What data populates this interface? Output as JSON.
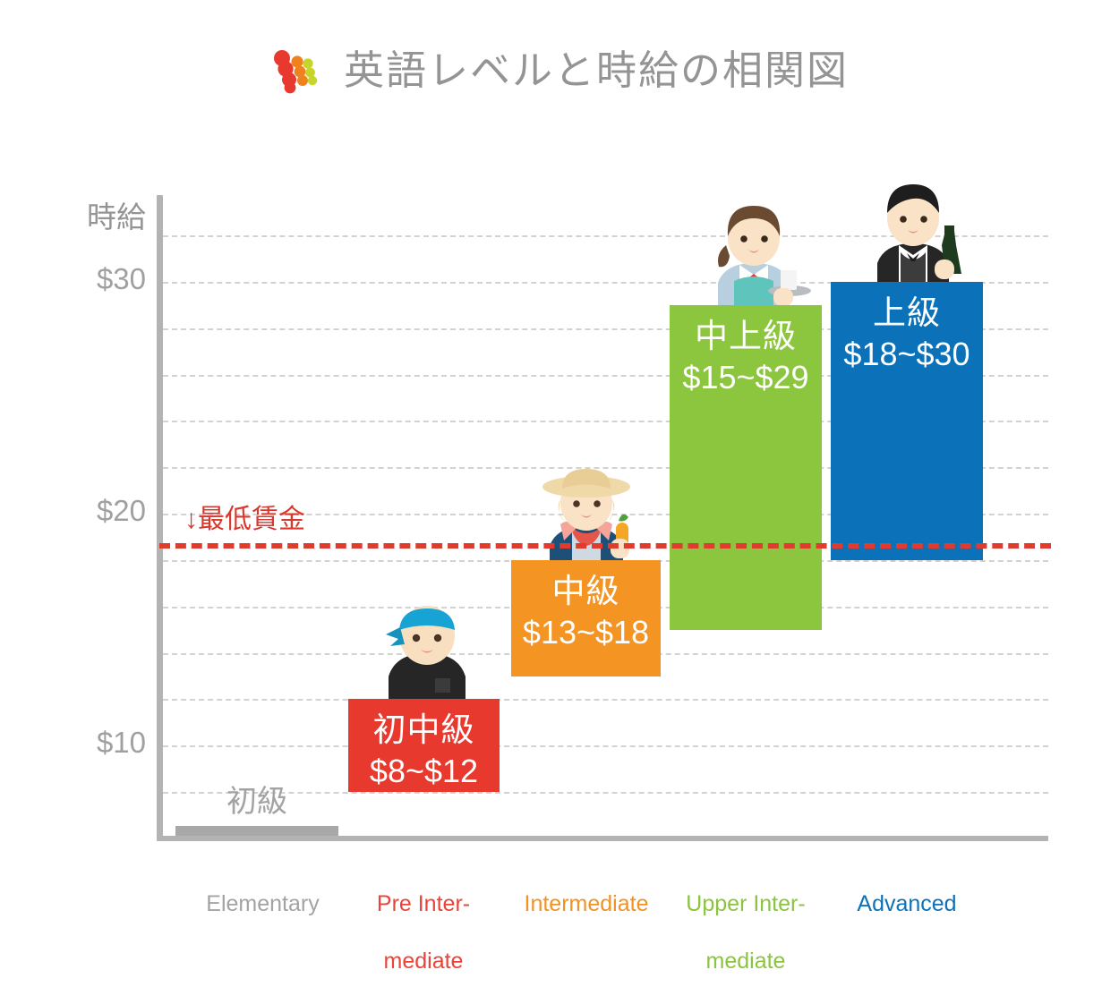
{
  "header": {
    "title": "英語レベルと時給の相関図",
    "logo_name": "three-stroke-brand-logo",
    "logo_colors": [
      "#e8392e",
      "#f0821e",
      "#c7d42a"
    ]
  },
  "chart_data": {
    "type": "bar",
    "title": "英語レベルと時給の相関図",
    "ylabel": "時給",
    "xlabel": "",
    "ylim": [
      0,
      32
    ],
    "grid": true,
    "grid_step": 2,
    "ytick_labels": [
      "$30",
      "$20",
      "$10"
    ],
    "ytick_values": [
      30,
      20,
      10
    ],
    "legend": "none",
    "currency": "USD per hour",
    "categories": [
      "Elementary",
      "Pre Intermediate",
      "Intermediate",
      "Upper Intermediate",
      "Advanced"
    ],
    "category_labels_ja": [
      "初級",
      "初中級",
      "中級",
      "中上級",
      "上級"
    ],
    "bars": [
      {
        "id": "elementary",
        "label_ja": "初級",
        "label_en": "Elementary",
        "label_en_line1": "Elementary",
        "label_en_line2": "",
        "range_text": "",
        "low": 0,
        "high": 0,
        "color": "#a8a8a8",
        "label_color": "#a3a3a3",
        "figure": "none"
      },
      {
        "id": "pre-intermediate",
        "label_ja": "初中級",
        "label_en": "Pre Intermediate",
        "label_en_line1": "Pre Inter-",
        "label_en_line2": "mediate",
        "range_text": "$8~$12",
        "low": 8,
        "high": 12,
        "color": "#e8392e",
        "label_color": "#e8453a",
        "figure": "boy-blue-bandana"
      },
      {
        "id": "intermediate",
        "label_ja": "中級",
        "label_en": "Intermediate",
        "label_en_line1": "Intermediate",
        "label_en_line2": "",
        "range_text": "$13~$18",
        "low": 13,
        "high": 18,
        "color": "#f39423",
        "label_color": "#f09324",
        "figure": "farmer-straw-hat-carrot"
      },
      {
        "id": "upper-intermediate",
        "label_ja": "中上級",
        "label_en": "Upper Intermediate",
        "label_en_line1": "Upper Inter-",
        "label_en_line2": "mediate",
        "range_text": "$15~$29",
        "low": 15,
        "high": 29,
        "color": "#8cc63e",
        "label_color": "#8bc53f",
        "figure": "waitress-tray"
      },
      {
        "id": "advanced",
        "label_ja": "上級",
        "label_en": "Advanced",
        "label_en_line1": "Advanced",
        "label_en_line2": "",
        "range_text": "$18~$30",
        "low": 18,
        "high": 30,
        "color": "#0b71b9",
        "label_color": "#0e72b8",
        "figure": "waiter-wine-bottle"
      }
    ],
    "annotations": [
      {
        "id": "minimum-wage",
        "text": "↓最低賃金",
        "value": 18.7,
        "color": "#d9382c",
        "style": "dashed-horizontal-line"
      }
    ]
  }
}
